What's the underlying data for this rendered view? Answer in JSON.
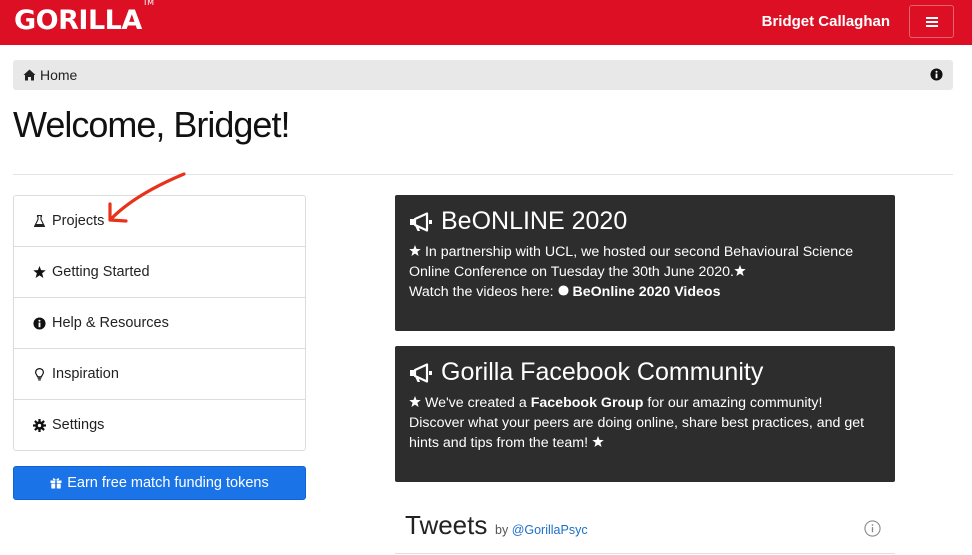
{
  "navbar": {
    "brand": "GORILLA",
    "brand_tm": "TM",
    "user_name": "Bridget Callaghan",
    "menu_icon": "hamburger-icon",
    "bg_color": "#dc0f24"
  },
  "breadcrumb": {
    "home_icon": "home-icon",
    "home_label": "Home",
    "info_icon": "info-icon"
  },
  "page": {
    "title": "Welcome, Bridget!"
  },
  "sidebar": {
    "items": [
      {
        "label": "Projects",
        "icon": "flask-icon"
      },
      {
        "label": "Getting Started",
        "icon": "star-icon"
      },
      {
        "label": "Help & Resources",
        "icon": "info-icon"
      },
      {
        "label": "Inspiration",
        "icon": "lightbulb-icon"
      },
      {
        "label": "Settings",
        "icon": "gear-icon"
      }
    ]
  },
  "earn_button": {
    "label": "Earn free match funding tokens",
    "icon": "gift-icon",
    "color": "#1a74e8"
  },
  "cards": [
    {
      "title": "BeONLINE 2020",
      "icon": "megaphone-icon",
      "line1": "In partnership with UCL, we hosted our second Behavioural Science Online Conference on Tuesday the 30th June 2020.",
      "line2_prefix": "Watch the videos here:",
      "line2_link": "BeOnline 2020 Videos"
    },
    {
      "title": "Gorilla Facebook Community",
      "icon": "megaphone-icon",
      "text_before": "We've created a",
      "text_bold": "Facebook Group",
      "text_after": "for our amazing community! Discover what your peers are doing online, share best practices, and get hints and tips from the team!"
    }
  ],
  "tweets": {
    "title": "Tweets",
    "by": "by",
    "handle": "@GorillaPsyc",
    "info_icon": "info-circle-icon"
  },
  "annotation": {
    "arrow_color": "#e8321a",
    "arrow_icon": "red-arrow-annotation"
  }
}
